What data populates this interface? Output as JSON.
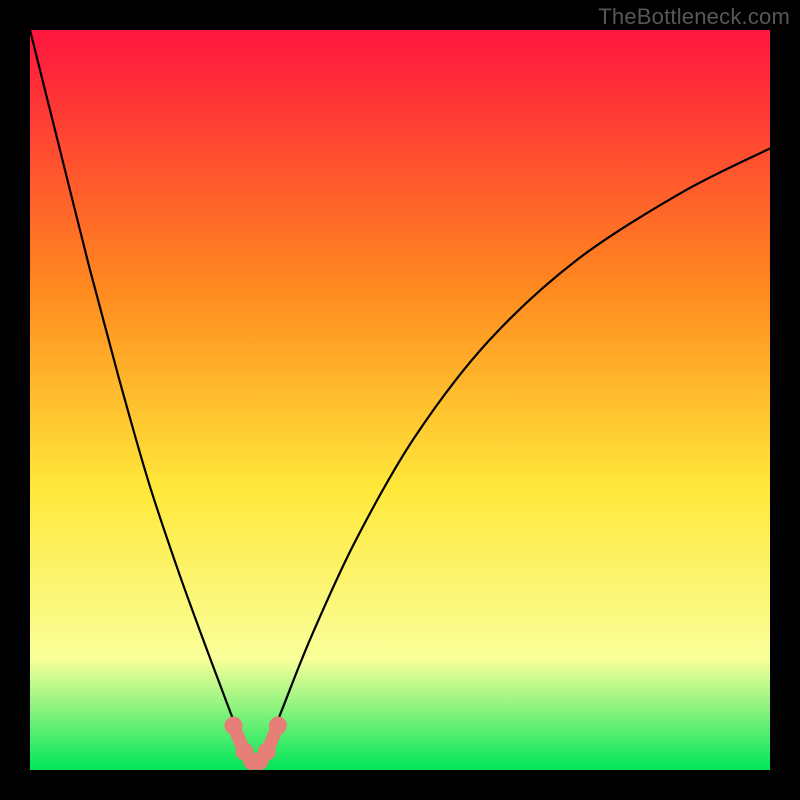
{
  "watermark": {
    "text": "TheBottleneck.com"
  },
  "colors": {
    "background_black": "#000000",
    "gradient_top": "#ff153f",
    "gradient_mid1": "#ff8a1f",
    "gradient_mid2": "#ffe83a",
    "gradient_low": "#f9ff9a",
    "gradient_base": "#00e55a",
    "curve": "#000000",
    "marker_fill": "#e57f77",
    "marker_stroke": "#c55"
  },
  "chart_data": {
    "type": "line",
    "title": "",
    "xlabel": "",
    "ylabel": "",
    "xlim": [
      0,
      100
    ],
    "ylim": [
      0,
      100
    ],
    "grid": false,
    "legend": false,
    "series": [
      {
        "name": "bottleneck-curve",
        "x": [
          0,
          4,
          8,
          12,
          16,
          20,
          24,
          27,
          29,
          30.5,
          32,
          34,
          38,
          44,
          52,
          62,
          74,
          88,
          100
        ],
        "values": [
          100,
          84,
          68,
          53,
          39,
          27,
          16,
          8,
          3,
          1,
          3,
          8,
          18,
          31,
          45,
          58,
          69,
          78,
          84
        ]
      }
    ],
    "markers": {
      "name": "highlight-dots",
      "x": [
        27.5,
        29.0,
        30.0,
        31.0,
        32.0,
        33.5
      ],
      "values": [
        6.0,
        2.5,
        1.2,
        1.2,
        2.5,
        6.0
      ]
    },
    "valley_x": 30.5
  }
}
